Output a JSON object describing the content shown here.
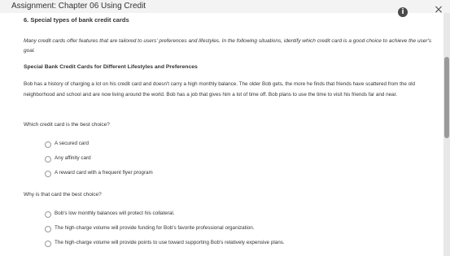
{
  "window": {
    "title": "Assignment: Chapter 06 Using Credit",
    "help_icon": "info-icon",
    "close_icon": "close-icon",
    "help_glyph": "i",
    "close_glyph": "×"
  },
  "question": {
    "title": "6. Special types of bank credit cards",
    "intro": "Many credit cards offer features that are tailored to users' preferences and lifestyles. In the following situations, identify which credit card is a good choice to achieve the user's goal.",
    "section_heading": "Special Bank Credit Cards for Different Lifestyles and Preferences",
    "scenario": "Bob has a history of charging a lot on his credit card and doesn't carry a high monthly balance. The older Bob gets, the more he finds that friends have scattered from the old neighborhood and school and are now living around the world. Bob has a job that gives him a lot of time off. Bob plans to use the time to visit his friends far and near.",
    "part1": {
      "prompt": "Which credit card is the best choice?",
      "options": [
        "A secured card",
        "Any affinity card",
        "A reward card with a frequent flyer program"
      ]
    },
    "part2": {
      "prompt": "Why is that card the best choice?",
      "options": [
        "Bob's low monthly balances will protect his collateral.",
        "The high-charge volume will provide funding for Bob's favorite professional organization.",
        "The high-charge volume will provide points to use toward supporting Bob's relatively expensive plans."
      ]
    }
  }
}
